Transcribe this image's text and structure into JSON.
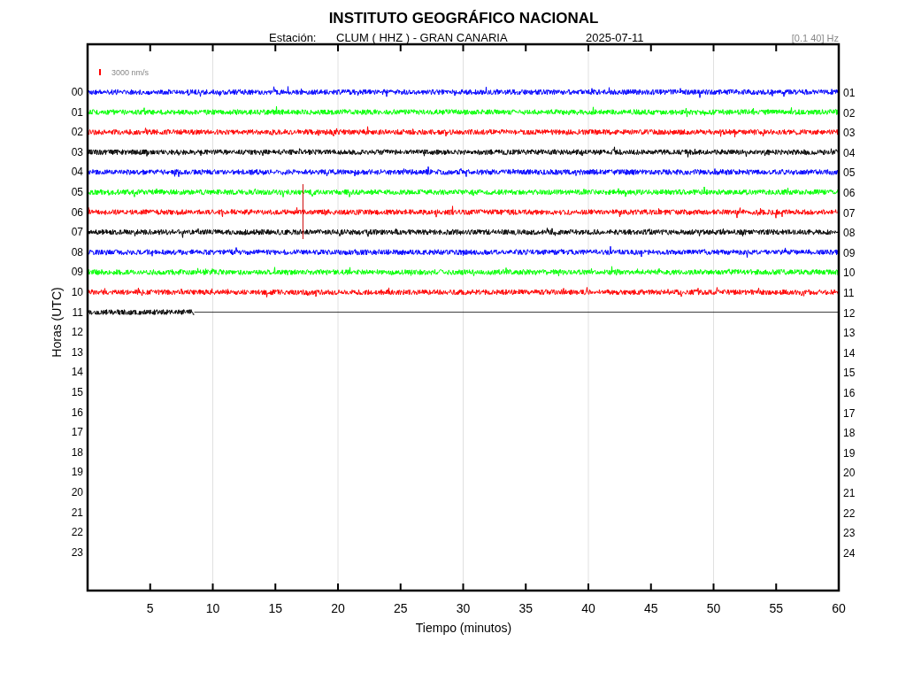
{
  "title": "INSTITUTO GEOGRÁFICO NACIONAL",
  "subtitle": {
    "station_label": "Estación:",
    "station": "CLUM ( HHZ ) - GRAN CANARIA",
    "date": "2025-07-11",
    "filter": "[0.1 40] Hz"
  },
  "scale": {
    "label": "3000 nm/s"
  },
  "ylabel": "Horas (UTC)",
  "xlabel": "Tiempo (minutos)",
  "left_labels": [
    "00",
    "01",
    "02",
    "03",
    "04",
    "05",
    "06",
    "07",
    "08",
    "09",
    "10",
    "11",
    "12",
    "13",
    "14",
    "15",
    "16",
    "17",
    "18",
    "19",
    "20",
    "21",
    "22",
    "23"
  ],
  "right_labels": [
    "01",
    "02",
    "03",
    "04",
    "05",
    "06",
    "07",
    "08",
    "09",
    "10",
    "11",
    "12",
    "13",
    "14",
    "15",
    "16",
    "17",
    "18",
    "19",
    "20",
    "21",
    "22",
    "23",
    "24"
  ],
  "xticks": [
    "5",
    "10",
    "15",
    "20",
    "25",
    "30",
    "35",
    "40",
    "45",
    "50",
    "55",
    "60"
  ],
  "traces": [
    {
      "color": "#0000ff",
      "level": 1
    },
    {
      "color": "#00ff00",
      "level": 1
    },
    {
      "color": "#ff0000",
      "level": 1
    },
    {
      "color": "#000000",
      "level": 1
    },
    {
      "color": "#0000ff",
      "level": 1
    },
    {
      "color": "#00ff00",
      "level": 1
    },
    {
      "color": "#ff0000",
      "level": 1
    },
    {
      "color": "#000000",
      "level": 1
    },
    {
      "color": "#0000ff",
      "level": 1
    },
    {
      "color": "#00ff00",
      "level": 1
    },
    {
      "color": "#ff0000",
      "level": 1
    },
    {
      "color": "#000000",
      "level": 0.142
    }
  ]
}
